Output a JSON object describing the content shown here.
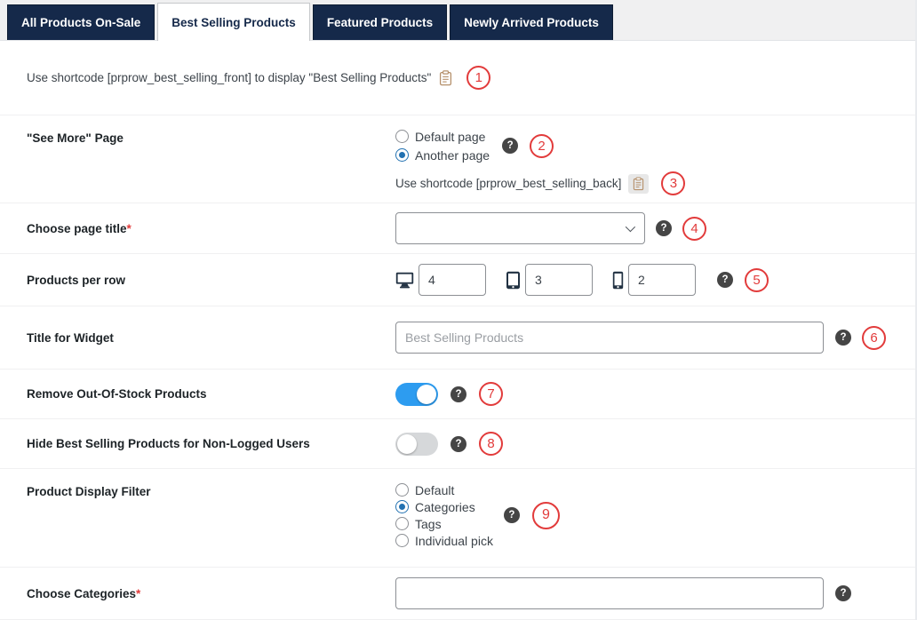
{
  "ui": {
    "help_glyph": "?"
  },
  "colors": {
    "tab_bg": "#15294a",
    "accent_red": "#e23b3b",
    "toggle_on": "#2d9cf0",
    "radio_selected": "#2271b1"
  },
  "tabs": [
    {
      "label": "All Products On-Sale",
      "active": false
    },
    {
      "label": "Best Selling Products",
      "active": true
    },
    {
      "label": "Featured Products",
      "active": false
    },
    {
      "label": "Newly Arrived Products",
      "active": false
    }
  ],
  "rows": {
    "shortcode_front": {
      "text": "Use shortcode [prprow_best_selling_front] to display \"Best Selling Products\"",
      "badge": "1"
    },
    "see_more": {
      "label": "\"See More\" Page",
      "options": [
        {
          "label": "Default page",
          "selected": false
        },
        {
          "label": "Another page",
          "selected": true
        }
      ],
      "badge": "2",
      "shortcode": {
        "text": "Use shortcode [prprow_best_selling_back]",
        "badge": "3"
      }
    },
    "page_title": {
      "label": "Choose page title",
      "required": "*",
      "value": "",
      "badge": "4"
    },
    "products_per_row": {
      "label": "Products per row",
      "desktop": "4",
      "tablet": "3",
      "mobile": "2",
      "badge": "5"
    },
    "widget_title": {
      "label": "Title for Widget",
      "placeholder": "Best Selling Products",
      "badge": "6"
    },
    "remove_oos": {
      "label": "Remove Out-Of-Stock Products",
      "on": true,
      "badge": "7"
    },
    "hide_non_logged": {
      "label": "Hide Best Selling Products for Non-Logged Users",
      "on": false,
      "badge": "8"
    },
    "display_filter": {
      "label": "Product Display Filter",
      "options": [
        {
          "label": "Default",
          "selected": false
        },
        {
          "label": "Categories",
          "selected": true
        },
        {
          "label": "Tags",
          "selected": false
        },
        {
          "label": "Individual pick",
          "selected": false
        }
      ],
      "badge": "9"
    },
    "choose_categories": {
      "label": "Choose Categories",
      "required": "*",
      "value": ""
    }
  }
}
